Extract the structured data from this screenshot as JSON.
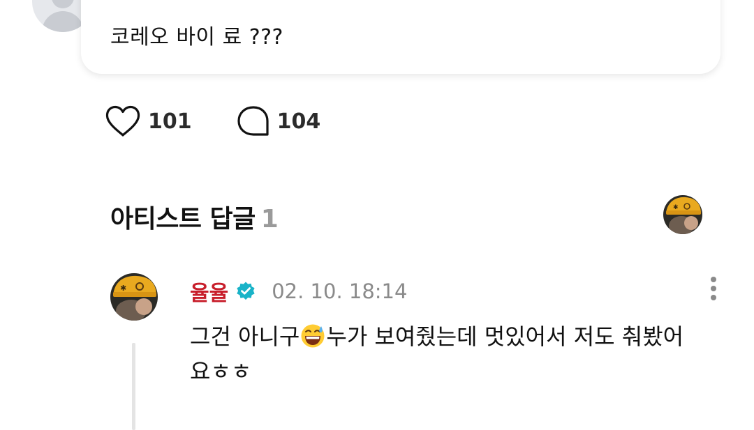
{
  "top_comment": {
    "text": "코레오 바이 료 ???"
  },
  "reactions": {
    "like_count": "101",
    "comment_count": "104"
  },
  "artist_replies": {
    "title": "아티스트 답글",
    "count": "1"
  },
  "reply": {
    "author": "율율",
    "timestamp": "02. 10. 18:14",
    "text_before_emoji": "그건 아니구",
    "emoji": "grinning-face-with-sweat-emoji",
    "text_after_emoji": "누가 보여줬는데 멋있어서 저도 춰봤어요ㅎㅎ"
  },
  "icons": {
    "like": "heart-icon",
    "comment": "speech-bubble-icon",
    "verified": "verified-badge-icon",
    "more": "more-vertical-icon"
  },
  "colors": {
    "author_name": "#c81e2b",
    "verified_badge": "#19b3c8",
    "timestamp": "#8a8a8a",
    "count_muted": "#9a9a9a",
    "avatar_hat": "#e9a91f"
  }
}
